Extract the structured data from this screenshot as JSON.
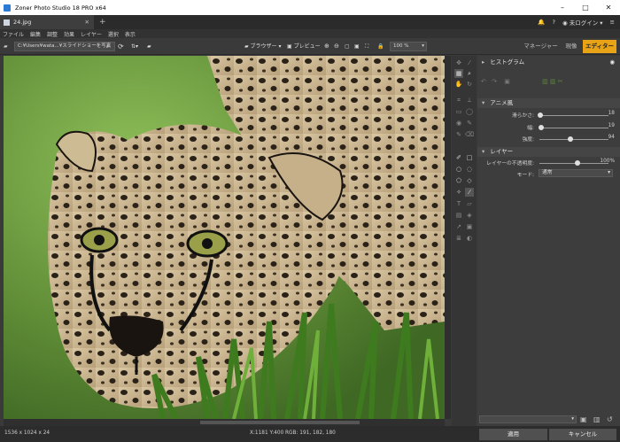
{
  "window": {
    "title": "Zoner Photo Studio 18 PRO x64"
  },
  "tabs": [
    {
      "label": "24.jpg"
    }
  ],
  "header": {
    "login": "未ログイン"
  },
  "menu": [
    "ファイル",
    "編集",
    "調整",
    "効果",
    "レイヤー",
    "選択",
    "表示"
  ],
  "toolbar": {
    "path": "C:¥Users¥wata...¥スライドショーを写真",
    "browser_label": "ブラウザー",
    "preview_label": "プレビュー",
    "zoom": "100 %"
  },
  "modes": {
    "manager": "マネージャー",
    "develop": "現像",
    "editor": "エディター"
  },
  "panel": {
    "histogram": "ヒストグラム",
    "anime_section": "アニメ風",
    "sliders": [
      {
        "label": "滑らかさ:",
        "value": "18",
        "fraction": 0.18
      },
      {
        "label": "幅:",
        "value": "19",
        "fraction": 0.19
      },
      {
        "label": "強度:",
        "value": "94",
        "fraction": 0.94
      }
    ],
    "layer_section": "レイヤー",
    "opacity_label": "レイヤーの不透明度:",
    "opacity_value": "100%",
    "opacity_fraction": 1.0,
    "mode_label": "モード:",
    "mode_value": "通常"
  },
  "status": {
    "dimensions": "1536 x 1024 x 24",
    "coords": "X:1181 Y:400",
    "rgb": "RGB: 191, 182, 180"
  },
  "buttons": {
    "apply": "適用",
    "cancel": "キャンセル"
  }
}
